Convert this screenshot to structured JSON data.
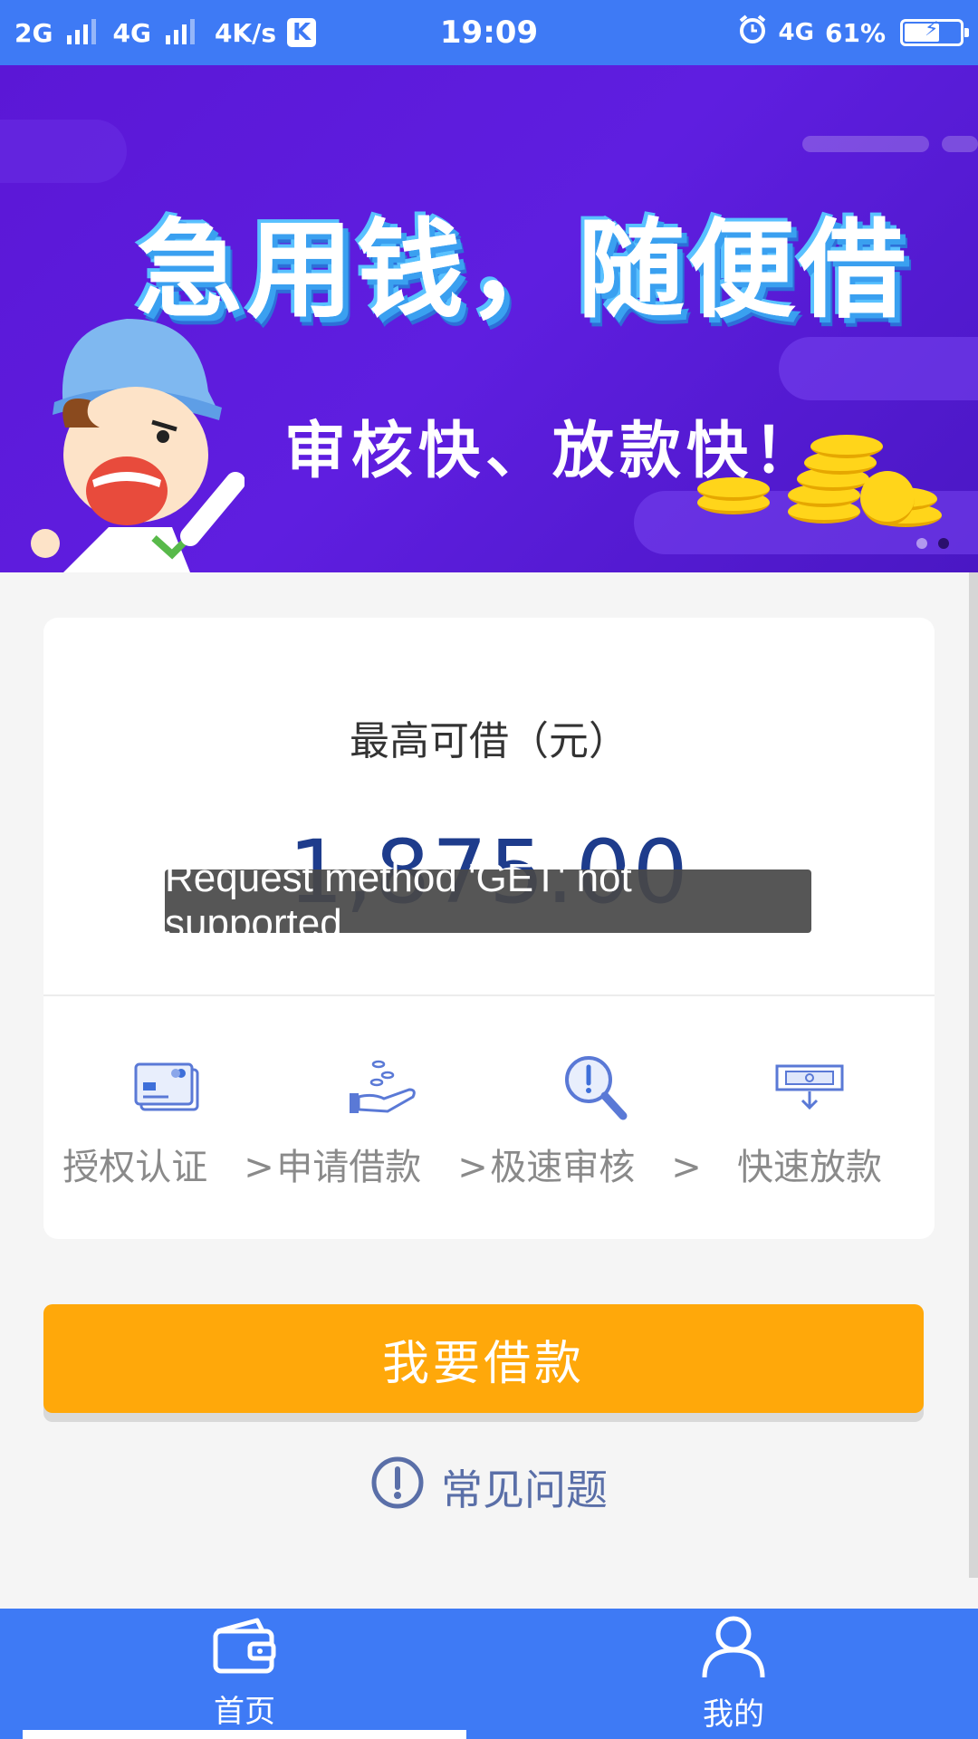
{
  "status_bar": {
    "net1": "2G",
    "net2": "4G",
    "speed": "4K/s",
    "k_icon": "K",
    "time": "19:09",
    "net3": "4G",
    "battery": "61%",
    "battery_level": 0.61
  },
  "banner": {
    "title": "急用钱，随便借",
    "subtitle": "审核快、放款快！",
    "slides": 2,
    "active_slide": 2
  },
  "card": {
    "title": "最高可借（元）",
    "amount": "1,875.00"
  },
  "steps": [
    {
      "label": "授权认证　>",
      "icon": "credit-card-icon"
    },
    {
      "label": "申请借款　>",
      "icon": "hand-coins-icon"
    },
    {
      "label": "极速审核　>",
      "icon": "magnifier-alert-icon"
    },
    {
      "label": "快速放款",
      "icon": "atm-cash-icon"
    }
  ],
  "toast": {
    "message": "Request method 'GET' not supported"
  },
  "cta": {
    "label": "我要借款",
    "color": "#ffa80a"
  },
  "faq": {
    "label": "常见问题",
    "icon": "exclamation-circle-icon"
  },
  "bottom_nav": {
    "items": [
      {
        "label": "首页",
        "icon": "wallet-icon",
        "active": true
      },
      {
        "label": "我的",
        "icon": "user-icon",
        "active": false
      }
    ]
  },
  "colors": {
    "primary": "#3e7af5",
    "banner_bg": "#5b17d6",
    "amount": "#1e3c8c",
    "accent": "#ffa80a"
  }
}
